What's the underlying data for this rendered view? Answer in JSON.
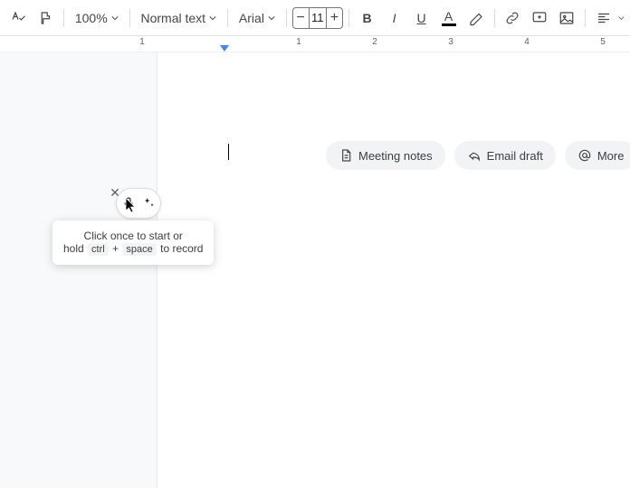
{
  "toolbar": {
    "zoom": "100%",
    "styles_label": "Normal text",
    "font_label": "Arial",
    "font_size": "11",
    "bold": "B",
    "italic": "I",
    "underline": "U",
    "text_color_letter": "A"
  },
  "ruler": {
    "labels": [
      "1",
      "1",
      "2",
      "3",
      "4",
      "5"
    ]
  },
  "chips": {
    "meeting_notes": "Meeting notes",
    "email_draft": "Email draft",
    "more": "More"
  },
  "tooltip": {
    "line1": "Click once to start or",
    "line2_prefix": "hold",
    "key1": "ctrl",
    "plus": "+",
    "key2": "space",
    "line2_suffix": "to record"
  }
}
